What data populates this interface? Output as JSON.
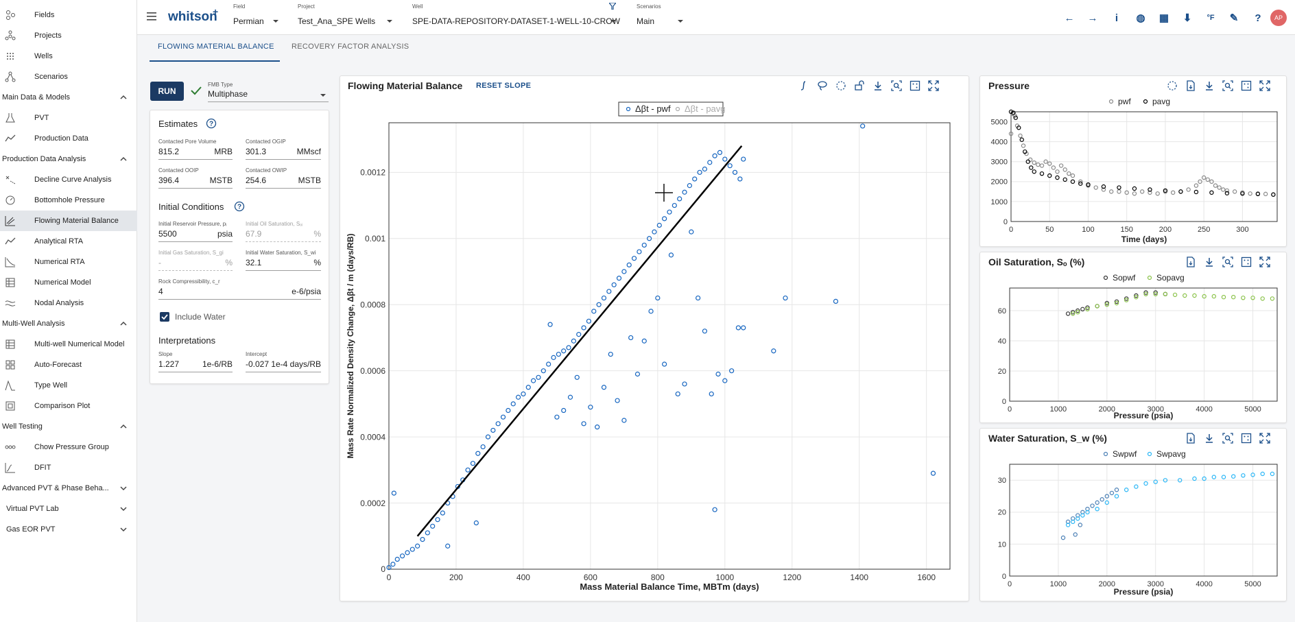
{
  "sidebar": {
    "top_items": [
      {
        "label": "Fields",
        "icon": "fields-icon"
      },
      {
        "label": "Projects",
        "icon": "projects-icon"
      },
      {
        "label": "Wells",
        "icon": "wells-icon"
      },
      {
        "label": "Scenarios",
        "icon": "scenarios-icon"
      }
    ],
    "sections": [
      {
        "label": "Main Data & Models",
        "items": [
          {
            "label": "PVT",
            "icon": "flask-icon"
          },
          {
            "label": "Production Data",
            "icon": "production-icon"
          }
        ]
      },
      {
        "label": "Production Data Analysis",
        "items": [
          {
            "label": "Decline Curve Analysis",
            "icon": "decline-icon"
          },
          {
            "label": "Bottomhole Pressure",
            "icon": "gauge-icon"
          },
          {
            "label": "Flowing Material Balance",
            "icon": "fmb-icon"
          },
          {
            "label": "Analytical RTA",
            "icon": "rta-icon"
          },
          {
            "label": "Numerical RTA",
            "icon": "numerical-rta-icon"
          },
          {
            "label": "Numerical Model",
            "icon": "model-icon"
          },
          {
            "label": "Nodal Analysis",
            "icon": "nodal-icon"
          }
        ]
      },
      {
        "label": "Multi-Well Analysis",
        "items": [
          {
            "label": "Multi-well Numerical Model",
            "icon": "multiwell-icon"
          },
          {
            "label": "Auto-Forecast",
            "icon": "grid-icon"
          },
          {
            "label": "Type Well",
            "icon": "typewell-icon"
          },
          {
            "label": "Comparison Plot",
            "icon": "comparison-icon"
          }
        ]
      },
      {
        "label": "Well Testing",
        "items": [
          {
            "label": "Chow Pressure Group",
            "icon": "chow-icon"
          },
          {
            "label": "DFIT",
            "icon": "dfit-icon"
          }
        ]
      }
    ],
    "collapsed": [
      "Advanced PVT & Phase Beha...",
      "Virtual PVT Lab",
      "Gas EOR PVT"
    ]
  },
  "topbar": {
    "logo": "whitson",
    "logo_sup": "+",
    "field": {
      "label": "Field",
      "value": "Permian"
    },
    "project": {
      "label": "Project",
      "value": "Test_Ana_SPE Wells"
    },
    "well": {
      "label": "Well",
      "value": "SPE-DATA-REPOSITORY-DATASET-1-WELL-10-CROW"
    },
    "scenario": {
      "label": "Scenarios",
      "value": "Main"
    },
    "icons": [
      "back-arrow-icon",
      "forward-arrow-icon",
      "info-icon",
      "globe-icon",
      "calculator-icon",
      "import-icon",
      "temperature-icon",
      "feedback-icon",
      "help-icon"
    ],
    "icon_glyphs": [
      "←",
      "→",
      "i",
      "◍",
      "▦",
      "⬇",
      "°F",
      "✎",
      "?"
    ],
    "avatar": "AP"
  },
  "tabs": [
    "FLOWING MATERIAL BALANCE",
    "RECOVERY FACTOR ANALYSIS"
  ],
  "left": {
    "run_label": "RUN",
    "fmb_type_label": "FMB Type",
    "fmb_type_value": "Multiphase",
    "estimates_title": "Estimates",
    "estimates": [
      {
        "label": "Contacted Pore Volume",
        "value": "815.2",
        "unit": "MRB"
      },
      {
        "label": "Contacted OGIP",
        "value": "301.3",
        "unit": "MMscf"
      },
      {
        "label": "Contacted OOIP",
        "value": "396.4",
        "unit": "MSTB"
      },
      {
        "label": "Contacted OWIP",
        "value": "254.6",
        "unit": "MSTB"
      }
    ],
    "initial_title": "Initial Conditions",
    "initial": [
      {
        "label": "Initial Reservoir Pressure, pᵢ",
        "value": "5500",
        "unit": "psia",
        "disabled": false
      },
      {
        "label": "Initial Oil Saturation, Sₒᵢ",
        "value": "67.9",
        "unit": "%",
        "disabled": true
      },
      {
        "label": "Initial Gas Saturation, S_gi",
        "value": "-",
        "unit": "%",
        "disabled": true
      },
      {
        "label": "Initial Water Saturation, S_wi",
        "value": "32.1",
        "unit": "%",
        "disabled": false
      }
    ],
    "rock": {
      "label": "Rock Compressibility, c_r",
      "value": "4",
      "unit": "e-6/psia"
    },
    "include_water": "Include Water",
    "interp_title": "Interpretations",
    "interp": [
      {
        "label": "Slope",
        "value": "1.227",
        "unit": "1e-6/RB"
      },
      {
        "label": "Intercept",
        "value": "-0.027",
        "unit": "1e-4 days/RB"
      }
    ]
  },
  "fmb_panel": {
    "title": "Flowing Material Balance",
    "reset_slope": "RESET SLOPE",
    "icons": [
      "integral-icon",
      "lasso-icon",
      "select-icon",
      "unlock-icon",
      "download-icon",
      "zoom-icon",
      "autoscale-icon",
      "fullscreen-icon"
    ],
    "legend": [
      "Δβt - pwf",
      "Δβt - pavg"
    ]
  },
  "pressure_panel": {
    "title": "Pressure",
    "legend": [
      "pwf",
      "pavg"
    ],
    "icons": [
      "select-icon",
      "file-icon",
      "download-icon",
      "zoom-icon",
      "autoscale-icon",
      "fullscreen-icon"
    ]
  },
  "oil_panel": {
    "title": "Oil Saturation, Sₒ (%)",
    "legend": [
      "Sopwf",
      "Sopavg"
    ],
    "icons": [
      "file-icon",
      "download-icon",
      "zoom-icon",
      "autoscale-icon",
      "fullscreen-icon"
    ]
  },
  "water_panel": {
    "title": "Water Saturation, S_w (%)",
    "legend": [
      "Swpwf",
      "Swpavg"
    ],
    "icons": [
      "file-icon",
      "download-icon",
      "zoom-icon",
      "autoscale-icon",
      "fullscreen-icon"
    ]
  },
  "colors": {
    "accent": "#1b4f8a",
    "pwf_blue": "#1565c0",
    "pavg_gray": "#888888",
    "oil_green": "#8bc34a",
    "water_cyan": "#29b6f6",
    "check_green": "#2e7d32"
  },
  "chart_data": [
    {
      "type": "scatter",
      "title": "Flowing Material Balance",
      "xlabel": "Mass Material Balance Time, MBTm (days)",
      "ylabel": "Mass Rate Normalized Density Change, Δβt / m (days/RB)",
      "xlim": [
        0,
        1670
      ],
      "ylim": [
        0,
        0.00135
      ],
      "xticks": [
        0,
        200,
        400,
        600,
        800,
        1000,
        1200,
        1400,
        1600
      ],
      "yticks": [
        0,
        0.0002,
        0.0004,
        0.0006,
        0.0008,
        0.001,
        0.0012
      ],
      "ytick_labels": [
        "0",
        "0.0002",
        "0.0004",
        "0.0006",
        "0.0008",
        "0.001",
        "0.0012"
      ],
      "grid": true,
      "legend_position": "top-center",
      "series": [
        {
          "name": "Δβt - pwf",
          "color": "#1565c0",
          "marker": "open-circle",
          "x": [
            0,
            12,
            25,
            40,
            55,
            70,
            85,
            100,
            115,
            130,
            145,
            160,
            175,
            190,
            205,
            220,
            235,
            250,
            265,
            280,
            295,
            310,
            325,
            340,
            355,
            370,
            385,
            400,
            415,
            430,
            445,
            460,
            475,
            490,
            505,
            520,
            535,
            550,
            565,
            580,
            595,
            610,
            625,
            640,
            655,
            670,
            685,
            700,
            715,
            730,
            745,
            760,
            775,
            790,
            805,
            820,
            835,
            850,
            865,
            880,
            895,
            910,
            925,
            940,
            955,
            970,
            985,
            1000,
            1015,
            1030,
            1045,
            1055,
            480,
            500,
            520,
            540,
            560,
            580,
            600,
            620,
            640,
            660,
            680,
            700,
            720,
            740,
            760,
            780,
            800,
            820,
            840,
            860,
            880,
            900,
            920,
            940,
            960,
            980,
            1000,
            1020,
            1040,
            1055,
            1145,
            1180,
            1330,
            1410,
            1620,
            970,
            260,
            15,
            175
          ],
          "y": [
            5e-06,
            1.5e-05,
            3e-05,
            4e-05,
            5e-05,
            6e-05,
            7e-05,
            9e-05,
            0.00011,
            0.00013,
            0.00015,
            0.00017,
            0.0002,
            0.00022,
            0.00025,
            0.00027,
            0.0003,
            0.00032,
            0.00035,
            0.00037,
            0.0004,
            0.00042,
            0.00044,
            0.00046,
            0.00048,
            0.0005,
            0.00052,
            0.00053,
            0.00055,
            0.00057,
            0.00058,
            0.0006,
            0.00062,
            0.00064,
            0.00065,
            0.00066,
            0.00067,
            0.00069,
            0.00071,
            0.00073,
            0.00075,
            0.00078,
            0.0008,
            0.00082,
            0.00084,
            0.00086,
            0.00088,
            0.0009,
            0.00092,
            0.00094,
            0.00096,
            0.00098,
            0.001,
            0.00102,
            0.00104,
            0.00106,
            0.00108,
            0.0011,
            0.00112,
            0.00114,
            0.00116,
            0.00118,
            0.0012,
            0.00121,
            0.00123,
            0.00125,
            0.00126,
            0.00124,
            0.00122,
            0.0012,
            0.00118,
            0.00124,
            0.00074,
            0.00046,
            0.00048,
            0.00052,
            0.00058,
            0.00044,
            0.00049,
            0.00043,
            0.00055,
            0.00065,
            0.00051,
            0.00045,
            0.0007,
            0.00059,
            0.00069,
            0.00078,
            0.00082,
            0.00062,
            0.00095,
            0.00053,
            0.00056,
            0.00102,
            0.00082,
            0.00072,
            0.00053,
            0.00059,
            0.00057,
            0.0006,
            0.00073,
            0.00073,
            0.00066,
            0.00082,
            0.00081,
            0.00134,
            0.00029,
            0.00018,
            0.00014,
            0.00023,
            7e-05
          ]
        },
        {
          "name": "Δβt - pavg",
          "color": "#aaaaaa",
          "marker": "open-circle",
          "x": [],
          "y": []
        },
        {
          "name": "slope line",
          "color": "#000000",
          "marker": "line",
          "x": [
            85,
            1050
          ],
          "y": [
            0.0001,
            0.00128
          ]
        }
      ]
    },
    {
      "type": "scatter",
      "title": "Pressure",
      "xlabel": "Time (days)",
      "ylabel": "",
      "xlim": [
        0,
        345
      ],
      "ylim": [
        0,
        5500
      ],
      "xticks": [
        0,
        50,
        100,
        150,
        200,
        250,
        300
      ],
      "yticks": [
        0,
        1000,
        2000,
        3000,
        4000,
        5000
      ],
      "grid": true,
      "legend_position": "top-center",
      "series": [
        {
          "name": "pwf",
          "color": "#888888",
          "marker": "open-circle",
          "x": [
            0,
            2,
            5,
            8,
            12,
            16,
            20,
            25,
            30,
            35,
            40,
            45,
            50,
            55,
            60,
            65,
            70,
            75,
            80,
            90,
            100,
            110,
            120,
            130,
            140,
            150,
            160,
            170,
            180,
            190,
            200,
            210,
            220,
            230,
            240,
            245,
            250,
            255,
            260,
            265,
            270,
            275,
            280,
            290,
            300,
            310,
            320,
            330,
            340
          ],
          "y": [
            4400,
            5400,
            5300,
            4800,
            4300,
            3800,
            3400,
            3100,
            2950,
            2850,
            2800,
            3000,
            2900,
            2700,
            2500,
            2800,
            2600,
            2400,
            2300,
            2000,
            1800,
            1700,
            1600,
            1500,
            1500,
            1450,
            1400,
            1500,
            1450,
            1400,
            1500,
            1450,
            1500,
            1600,
            1800,
            2000,
            2200,
            2100,
            2000,
            1800,
            1700,
            1600,
            1550,
            1500,
            1450,
            1400,
            1400,
            1380,
            1350
          ]
        },
        {
          "name": "pavg",
          "color": "#000000",
          "marker": "open-circle",
          "x": [
            0,
            3,
            6,
            10,
            14,
            18,
            22,
            26,
            30,
            40,
            50,
            60,
            70,
            80,
            90,
            100,
            120,
            140,
            160,
            180,
            200,
            220,
            240,
            260,
            280,
            300,
            320,
            340
          ],
          "y": [
            5500,
            5450,
            5200,
            4700,
            4100,
            3500,
            3000,
            2700,
            2500,
            2400,
            2300,
            2200,
            2100,
            2000,
            1900,
            1850,
            1750,
            1700,
            1650,
            1600,
            1550,
            1500,
            1480,
            1450,
            1420,
            1400,
            1380,
            1350
          ]
        }
      ]
    },
    {
      "type": "scatter",
      "title": "Oil Saturation, So (%)",
      "xlabel": "Pressure (psia)",
      "ylabel": "",
      "xlim": [
        0,
        5500
      ],
      "ylim": [
        0,
        75
      ],
      "xticks": [
        0,
        1000,
        2000,
        3000,
        4000,
        5000
      ],
      "yticks": [
        0,
        20,
        40,
        60
      ],
      "grid": true,
      "legend_position": "top-center",
      "series": [
        {
          "name": "Sopwf",
          "color": "#333333",
          "marker": "open-circle",
          "x": [
            1200,
            1300,
            1400,
            1500,
            1600,
            1800,
            2000,
            2200,
            2400,
            2600,
            2800,
            3000,
            3200
          ],
          "y": [
            58,
            59,
            60,
            61,
            62,
            63,
            65,
            66,
            68,
            70,
            72,
            72,
            71
          ]
        },
        {
          "name": "Sopavg",
          "color": "#8bc34a",
          "marker": "open-circle",
          "x": [
            1300,
            1400,
            1600,
            1800,
            2000,
            2200,
            2400,
            2600,
            2800,
            3000,
            3200,
            3400,
            3600,
            3800,
            4000,
            4200,
            4400,
            4600,
            4800,
            5000,
            5200,
            5400
          ],
          "y": [
            58,
            59,
            61,
            63,
            64,
            65,
            67,
            69,
            71,
            71,
            71,
            70.5,
            70,
            70,
            69.5,
            69.5,
            69,
            69,
            68.5,
            68.5,
            68,
            68
          ]
        }
      ]
    },
    {
      "type": "scatter",
      "title": "Water Saturation, Sw (%)",
      "xlabel": "Pressure (psia)",
      "ylabel": "",
      "xlim": [
        0,
        5500
      ],
      "ylim": [
        0,
        35
      ],
      "xticks": [
        0,
        1000,
        2000,
        3000,
        4000,
        5000
      ],
      "yticks": [
        0,
        10,
        20,
        30
      ],
      "grid": true,
      "legend_position": "top-center",
      "series": [
        {
          "name": "Swpwf",
          "color": "#4a7fb5",
          "marker": "open-circle",
          "x": [
            1100,
            1200,
            1300,
            1400,
            1500,
            1600,
            1700,
            1800,
            1900,
            2000,
            2100,
            2200,
            1350,
            1450
          ],
          "y": [
            12,
            17,
            18,
            19,
            20,
            21,
            22,
            23,
            24,
            25,
            26,
            27,
            13,
            16
          ]
        },
        {
          "name": "Swpavg",
          "color": "#29b6f6",
          "marker": "open-circle",
          "x": [
            1200,
            1300,
            1400,
            1500,
            1600,
            1800,
            2000,
            2200,
            2400,
            2600,
            2800,
            3000,
            3200,
            3500,
            3800,
            4000,
            4200,
            4400,
            4600,
            4800,
            5000,
            5200,
            5400
          ],
          "y": [
            16,
            17,
            18,
            19,
            20,
            21,
            23,
            25,
            27,
            28,
            29,
            29.5,
            30,
            30,
            30.5,
            30.5,
            31,
            31,
            31.2,
            31.5,
            31.7,
            32,
            32
          ]
        }
      ]
    }
  ]
}
